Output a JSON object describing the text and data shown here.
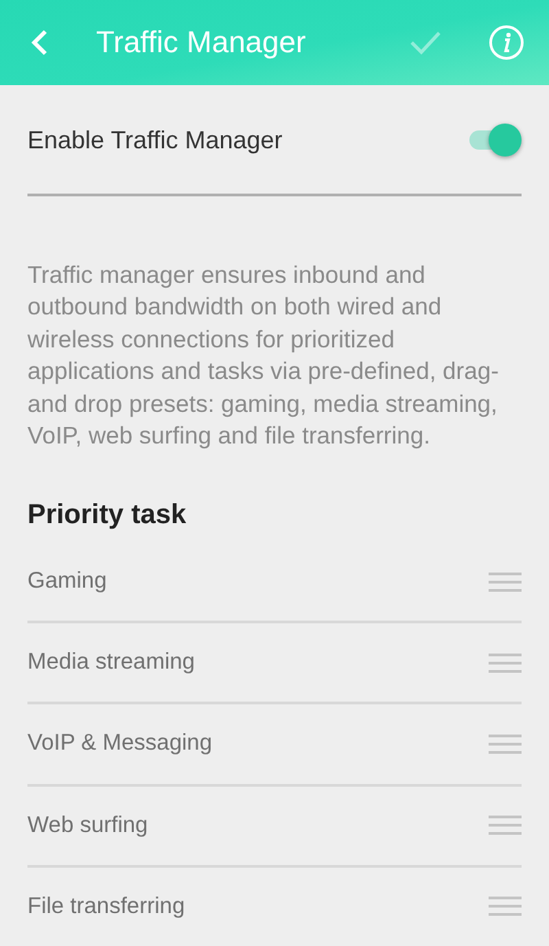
{
  "header": {
    "title": "Traffic Manager",
    "save": {
      "disabled": true
    }
  },
  "enable": {
    "label": "Enable Traffic Manager",
    "on": true
  },
  "description": "Traffic manager ensures inbound and outbound bandwidth on both wired and wireless connections for prioritized applications and tasks via pre-defined, drag-and drop presets: gaming, media streaming, VoIP, web surfing and file transferring.",
  "priority": {
    "title": "Priority task",
    "items": [
      {
        "label": "Gaming"
      },
      {
        "label": "Media streaming"
      },
      {
        "label": "VoIP & Messaging"
      },
      {
        "label": "Web surfing"
      },
      {
        "label": "File transferring"
      }
    ]
  }
}
